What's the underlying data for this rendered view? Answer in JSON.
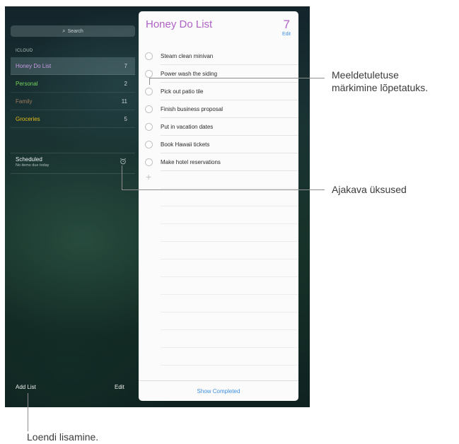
{
  "sidebar": {
    "search_placeholder": "Search",
    "section_header": "ICLOUD",
    "lists": [
      {
        "name": "Honey Do List",
        "count": "7",
        "color": "#c59be0"
      },
      {
        "name": "Personal",
        "count": "2",
        "color": "#73d35a"
      },
      {
        "name": "Family",
        "count": "11",
        "color": "#9d7a5c"
      },
      {
        "name": "Groceries",
        "count": "5",
        "color": "#e3be17"
      }
    ],
    "scheduled": {
      "title": "Scheduled",
      "subtitle": "No items due today"
    },
    "add_list_label": "Add List",
    "edit_label": "Edit"
  },
  "list_panel": {
    "title": "Honey Do List",
    "count": "7",
    "edit_label": "Edit",
    "reminders": [
      "Steam clean minivan",
      "Power wash the siding",
      "Pick out patio tile",
      "Finish business proposal",
      "Put in vacation dates",
      "Book Hawaii tickets",
      "Make hotel reservations"
    ],
    "add_symbol": "+",
    "show_completed_label": "Show Completed"
  },
  "callouts": {
    "mark_complete_line1": "Meeldetuletuse",
    "mark_complete_line2": "märkimine lõpetatuks.",
    "scheduled_items": "Ajakava üksused",
    "add_list": "Loendi lisamine."
  },
  "colors": {
    "accent_purple": "#b062c4",
    "link_blue": "#3d8fe0"
  }
}
